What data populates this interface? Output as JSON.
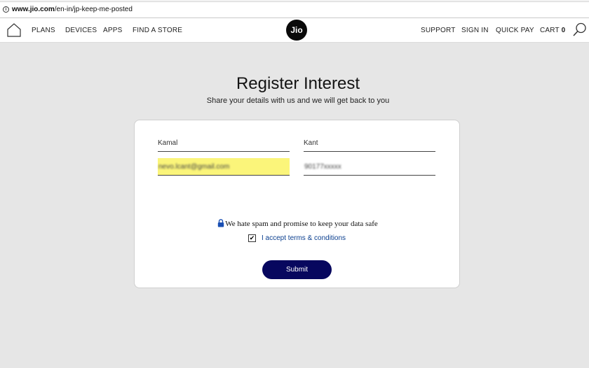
{
  "browser": {
    "url_host": "www.jio.com",
    "url_path": "/en-in/jp-keep-me-posted"
  },
  "nav": {
    "home_icon": "home-icon",
    "left_items": [
      "PLANS",
      "DEVICES",
      "APPS",
      "FIND A STORE"
    ],
    "logo_text": "Jio",
    "support": "SUPPORT",
    "sign_in": "SIGN IN",
    "quick_pay": "QUICK PAY",
    "cart_label": "CART",
    "cart_count": "0",
    "search_icon": "search-icon"
  },
  "page": {
    "title": "Register Interest",
    "subtitle": "Share your details with us and we will get back to you"
  },
  "form": {
    "first_name": "Kamal",
    "last_name": "Kant",
    "email": "nevo.lcant@gmail.com",
    "phone": "90177xxxxx",
    "spam_notice": "We hate spam and promise to keep your data safe",
    "terms_label": "I accept terms & conditions",
    "terms_checked": true,
    "submit_label": "Submit"
  },
  "colors": {
    "accent": "#07075e",
    "link": "#0b3f8f",
    "highlight": "#fbf57a",
    "background": "#e6e6e6"
  }
}
